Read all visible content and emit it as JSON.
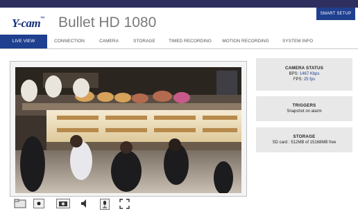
{
  "header": {
    "logo_text": "Y-cam",
    "model_title": "Bullet HD 1080",
    "smart_setup_label": "SMART SETUP"
  },
  "nav": {
    "tabs": [
      {
        "label": "LIVE VIEW",
        "active": true
      },
      {
        "label": "CONNECTION",
        "active": false
      },
      {
        "label": "CAMERA",
        "active": false
      },
      {
        "label": "STORAGE",
        "active": false
      },
      {
        "label": "TIMED RECORDING",
        "active": false
      },
      {
        "label": "MOTION RECORDING",
        "active": false
      },
      {
        "label": "SYSTEM INFO",
        "active": false
      }
    ]
  },
  "controls": [
    {
      "icon": "folder-icon"
    },
    {
      "icon": "record-icon"
    },
    {
      "icon": "snapshot-camera-icon"
    },
    {
      "icon": "speaker-icon"
    },
    {
      "icon": "microphone-icon"
    },
    {
      "icon": "fullscreen-icon"
    }
  ],
  "status": {
    "camera": {
      "title": "CAMERA STATUS",
      "bps_label": "BPS:",
      "bps_value": "1467 Kbps",
      "fps_label": "FPS:",
      "fps_value": "25 fps"
    },
    "triggers": {
      "title": "TRIGGERS",
      "text": "Snapshot on alarm"
    },
    "storage": {
      "title": "STORAGE",
      "text": "SD card : 512MB of 15168MB free"
    }
  },
  "colors": {
    "brand_blue": "#1f3f8f",
    "top_bar": "#2f2f5f",
    "panel_bg": "#e8e8e8",
    "value_blue": "#1f3f8f"
  }
}
